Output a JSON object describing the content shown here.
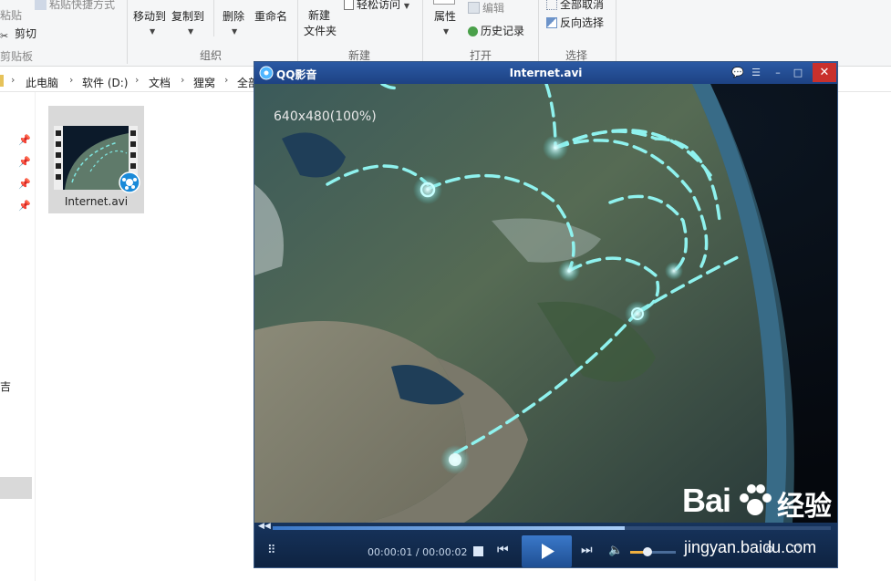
{
  "ribbon": {
    "paste_shortcut": "粘贴快捷方式",
    "paste": "粘贴",
    "cut": "剪切",
    "clipboard_group": "剪贴板",
    "move_to": "移动到",
    "copy_to": "复制到",
    "delete": "删除",
    "rename": "重命名",
    "organize_group": "组织",
    "new_folder_line1": "新建",
    "new_folder_line2": "文件夹",
    "easy_access": "轻松访问",
    "new_group": "新建",
    "properties": "属性",
    "edit": "编辑",
    "history": "历史记录",
    "open_group": "打开",
    "select_all": "全部取消",
    "invert_selection": "反向选择",
    "select_group": "选择"
  },
  "address": {
    "crumbs": [
      "此电脑",
      "软件 (D:)",
      "文档",
      "狸窝",
      "全部"
    ]
  },
  "nav": {
    "fragment": "吉"
  },
  "file": {
    "name": "Internet.avi"
  },
  "player": {
    "app_name": "QQ影音",
    "title": "Internet.avi",
    "resolution": "640x480(100%)",
    "time": "00:00:01 / 00:00:02",
    "progress": 0.63,
    "volume": 0.35
  },
  "watermark": {
    "brand": "Bai",
    "brand2": "经验",
    "url": "jingyan.baidu.com"
  },
  "colors": {
    "titlebar": "#1d4283",
    "close": "#c9302c",
    "accent": "#3a78c9",
    "volume": "#f0b040"
  }
}
